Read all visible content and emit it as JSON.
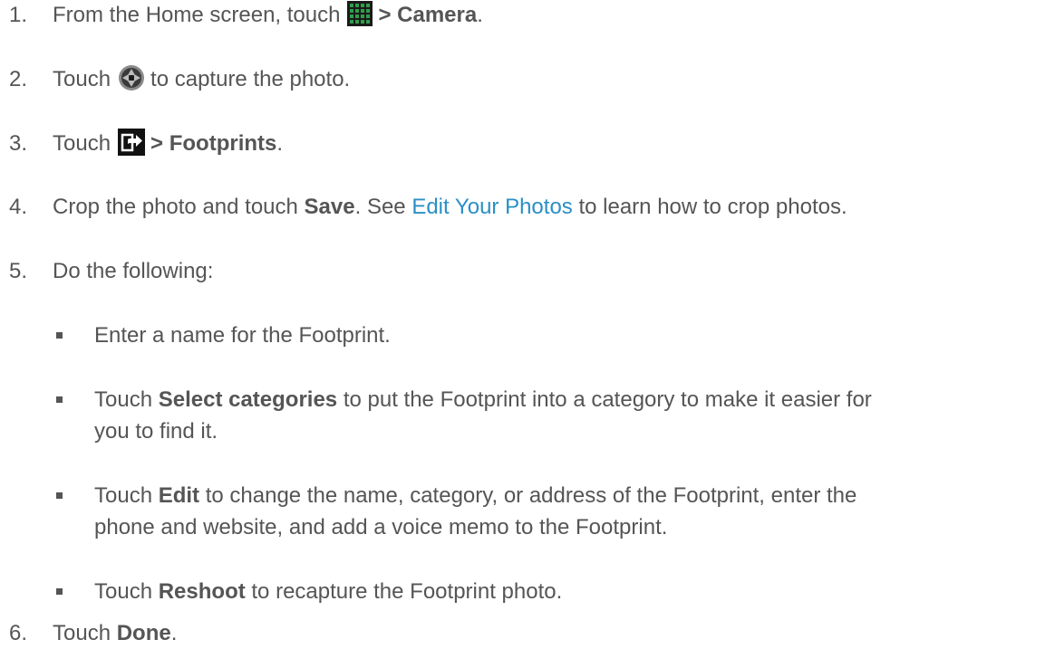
{
  "steps": [
    {
      "num": "1.",
      "pre": "From the Home screen, touch",
      "icon": "grid-icon",
      "post_bold": "> Camera",
      "post": "."
    },
    {
      "num": "2.",
      "pre": "Touch",
      "icon": "camera-shutter-icon",
      "post": "to capture the photo."
    },
    {
      "num": "3.",
      "pre": "Touch",
      "icon": "share-icon",
      "post_bold": "> Footprints",
      "post": "."
    },
    {
      "num": "4.",
      "pre": "Crop the photo and touch",
      "bold": "Save",
      "mid": ". See",
      "link": "Edit Your Photos",
      "post": "to learn how to crop photos."
    },
    {
      "num": "5.",
      "text": "Do the following:"
    },
    {
      "num": "6.",
      "pre": "Touch",
      "bold": "Done",
      "post": "."
    }
  ],
  "bullets": [
    {
      "text": "Enter a name for the Footprint."
    },
    {
      "pre": "Touch",
      "bold": "Select categories",
      "post": "to put the Footprint into a category to make it easier for",
      "cont": "you to find it."
    },
    {
      "pre": "Touch",
      "bold": "Edit",
      "post": "to change the name, category, or address of the Footprint, enter the",
      "cont": "phone and website, and add a voice memo to the Footprint."
    },
    {
      "pre": "Touch",
      "bold": "Reshoot",
      "post": "to recapture the Footprint photo."
    }
  ]
}
